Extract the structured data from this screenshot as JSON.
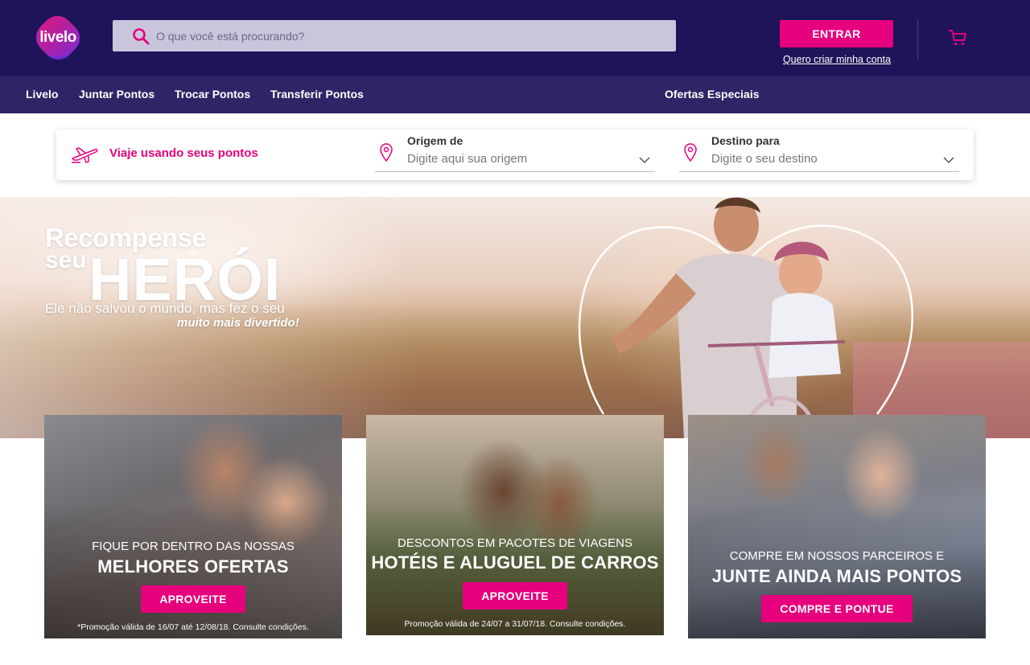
{
  "brand": {
    "logo_text": "livelo"
  },
  "header": {
    "search_placeholder": "O que você está procurando?",
    "login_button": "ENTRAR",
    "create_account_link": "Quero criar minha conta"
  },
  "nav": {
    "items": [
      "Livelo",
      "Juntar Pontos",
      "Trocar Pontos",
      "Transferir Pontos"
    ],
    "special": "Ofertas Especiais"
  },
  "travel": {
    "title": "Viaje usando seus pontos",
    "origin_label": "Origem de",
    "origin_placeholder": "Digite aqui sua origem",
    "destination_label": "Destino para",
    "destination_placeholder": "Digite o seu destino"
  },
  "hero": {
    "line1": "Recompense",
    "line2": "seu",
    "line3": "HERÓI",
    "line4": "Ele não salvou o mundo, mas fez o seu",
    "line5": "muito mais divertido!"
  },
  "cards": [
    {
      "kicker": "FIQUE POR DENTRO DAS NOSSAS",
      "headline": "MELHORES OFERTAS",
      "cta": "APROVEITE",
      "fine": "*Promoção válida de 16/07 até 12/08/18. Consulte condições."
    },
    {
      "kicker": "DESCONTOS EM PACOTES DE VIAGENS",
      "headline": "HOTÉIS E ALUGUEL DE CARROS",
      "cta": "APROVEITE",
      "fine": "Promoção válida de 24/07 a 31/07/18. Consulte condições."
    },
    {
      "kicker": "COMPRE EM NOSSOS PARCEIROS E",
      "headline": "JUNTE AINDA MAIS PONTOS",
      "cta": "COMPRE E PONTUE",
      "fine": ""
    }
  ],
  "colors": {
    "header_bg": "#1f1459",
    "nav_bg": "#2f2466",
    "accent": "#e6007e"
  },
  "icons": [
    "search-icon",
    "cart-icon",
    "plane-icon",
    "location-pin-icon",
    "chevron-down-icon"
  ]
}
